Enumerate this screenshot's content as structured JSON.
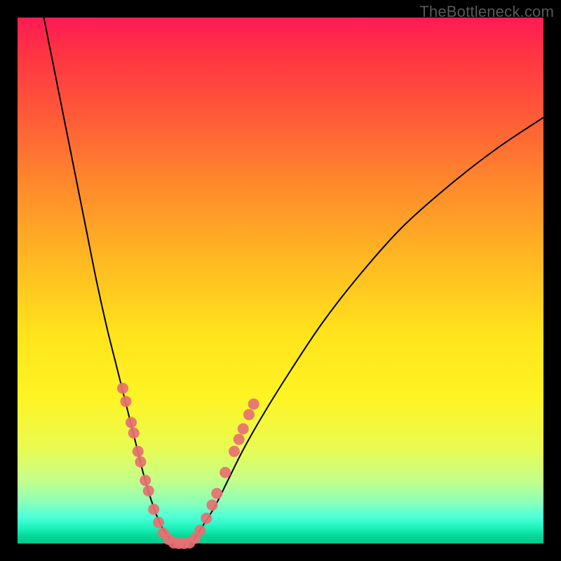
{
  "watermark": "TheBottleneck.com",
  "colors": {
    "frame": "#000000",
    "curve": "#000000",
    "dot_fill": "#e77072",
    "dot_stroke": "#c95256"
  },
  "chart_data": {
    "type": "line",
    "title": "",
    "xlabel": "",
    "ylabel": "",
    "xlim": [
      0,
      100
    ],
    "ylim": [
      0,
      100
    ],
    "note": "No axis tick labels are visible; x/y units are normalized 0–100 estimated from pixel position.",
    "series": [
      {
        "name": "left-curve",
        "x": [
          5,
          7,
          9,
          11,
          13,
          15,
          17,
          19,
          21,
          22.5,
          24,
          25.5,
          27,
          28.5,
          30
        ],
        "y": [
          100,
          90,
          80,
          70,
          60,
          50,
          41,
          33,
          25,
          19,
          13,
          8,
          4,
          1.5,
          0
        ]
      },
      {
        "name": "right-curve",
        "x": [
          33,
          35,
          37.5,
          40,
          43,
          47,
          52,
          58,
          65,
          73,
          82,
          91,
          100
        ],
        "y": [
          0,
          3,
          7,
          12,
          18,
          25,
          33,
          42,
          51,
          60,
          68,
          75,
          81
        ]
      }
    ],
    "flat_segment": {
      "x": [
        30,
        33
      ],
      "y": [
        0,
        0
      ]
    },
    "scatter": [
      {
        "name": "left-dots",
        "points": [
          {
            "x": 20.0,
            "y": 29.5
          },
          {
            "x": 20.6,
            "y": 27.0
          },
          {
            "x": 21.6,
            "y": 23.0
          },
          {
            "x": 22.1,
            "y": 21.0
          },
          {
            "x": 22.9,
            "y": 17.5
          },
          {
            "x": 23.4,
            "y": 15.5
          },
          {
            "x": 24.3,
            "y": 12.0
          },
          {
            "x": 24.9,
            "y": 10.0
          },
          {
            "x": 25.9,
            "y": 6.5
          },
          {
            "x": 26.8,
            "y": 4.0
          },
          {
            "x": 27.7,
            "y": 2.0
          },
          {
            "x": 28.7,
            "y": 0.8
          }
        ]
      },
      {
        "name": "bottom-dots",
        "points": [
          {
            "x": 29.7,
            "y": 0.1
          },
          {
            "x": 30.7,
            "y": 0.0
          },
          {
            "x": 31.7,
            "y": 0.0
          },
          {
            "x": 32.7,
            "y": 0.1
          }
        ]
      },
      {
        "name": "right-dots",
        "points": [
          {
            "x": 33.8,
            "y": 1.0
          },
          {
            "x": 34.7,
            "y": 2.5
          },
          {
            "x": 35.9,
            "y": 4.8
          },
          {
            "x": 37.0,
            "y": 7.3
          },
          {
            "x": 37.9,
            "y": 9.5
          },
          {
            "x": 39.5,
            "y": 13.5
          },
          {
            "x": 41.2,
            "y": 17.5
          },
          {
            "x": 42.1,
            "y": 19.8
          },
          {
            "x": 42.9,
            "y": 21.8
          },
          {
            "x": 44.0,
            "y": 24.5
          },
          {
            "x": 44.9,
            "y": 26.5
          }
        ]
      }
    ]
  }
}
